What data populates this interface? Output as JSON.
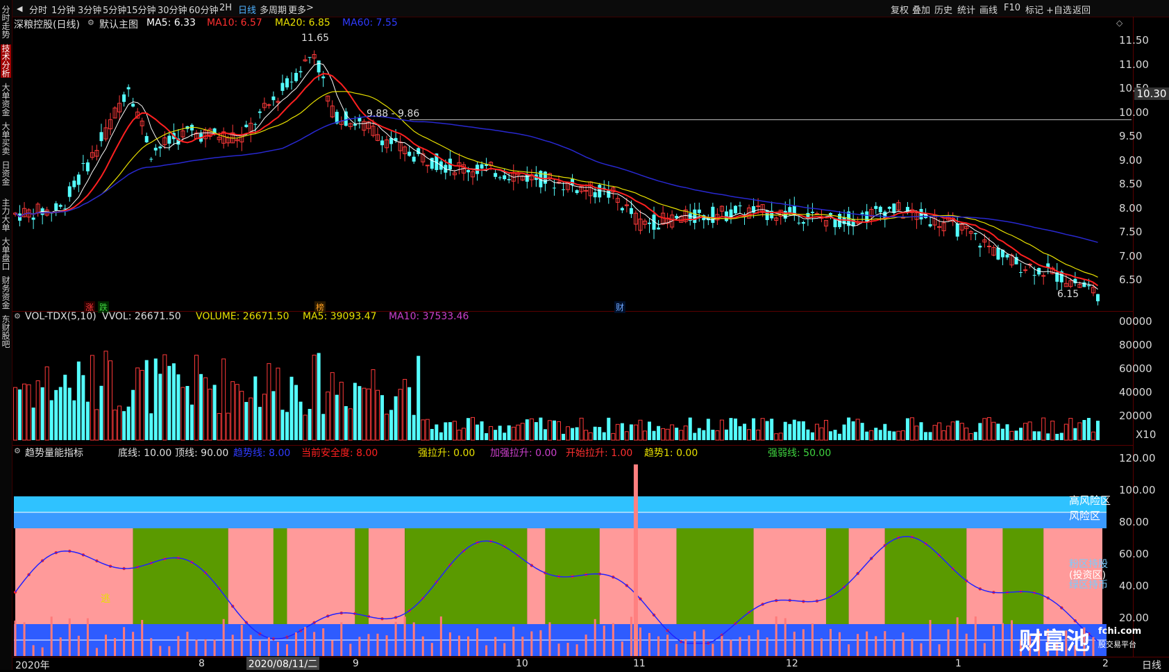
{
  "topbar": {
    "periods": [
      "分时",
      "1分钟",
      "3分钟",
      "5分钟",
      "15分钟",
      "30分钟",
      "60分钟",
      "2H",
      "日线",
      "多周期",
      "更多"
    ],
    "active_period": "日线",
    "right_items": [
      "复权",
      "叠加",
      "历史",
      "统计",
      "画线",
      "F10",
      "标记",
      "+自选",
      "返回"
    ]
  },
  "leftbar": {
    "items": [
      "分时走势",
      "技术分析",
      "大单资金",
      "大单买卖",
      "日资金",
      "主力大单",
      "大单盘口",
      "财务资金",
      "东财股吧"
    ],
    "active": "技术分析"
  },
  "main": {
    "title": "深粮控股(日线)",
    "subtitle": "默认主图",
    "ma5": "MA5: 6.33",
    "ma10": "MA10: 6.57",
    "ma20": "MA20: 6.85",
    "ma60": "MA60: 7.55",
    "high_label": "11.65",
    "low_label": "6.15",
    "hline_label": "9.88 - 9.86",
    "price_axis": [
      "11.50",
      "11.00",
      "10.50",
      "10.00",
      "9.50",
      "9.00",
      "8.50",
      "8.00",
      "7.50",
      "7.00",
      "6.50"
    ],
    "current_price": "10.30",
    "badges": [
      "涨",
      "跌",
      "榜",
      "财"
    ]
  },
  "volume": {
    "title": "VOL-TDX(5,10)",
    "vvol": "VVOL: 26671.50",
    "volume": "VOLUME: 26671.50",
    "ma5": "MA5: 39093.47",
    "ma10": "MA10: 37533.46",
    "axis": [
      "00000",
      "80000",
      "60000",
      "40000",
      "20000"
    ],
    "axis_unit": "X10"
  },
  "indicator": {
    "title": "趋势量能指标",
    "bottom_line": "底线: 10.00",
    "top_line": "顶线: 90.00",
    "trend_line": "趋势线: 8.00",
    "safety": "当前安全度: 8.00",
    "strong_up": "强拉升: 0.00",
    "add_up": "加强拉升: 0.00",
    "start_up": "开始拉升: 1.00",
    "trend1": "趋势1: 0.00",
    "strength_line": "强弱线: 50.00",
    "axis": [
      "120.00",
      "100.00",
      "80.00",
      "60.00",
      "40.00",
      "20.00"
    ],
    "zones": {
      "high_risk": "高风险区",
      "risk": "风险区",
      "invest": "(投资区)",
      "pink_zone": "粉区持股",
      "green_zone": "绿区持币"
    },
    "escape_label": "逃"
  },
  "bottom_axis": {
    "labels": [
      "2020年",
      "8",
      "2020/08/11/二",
      "9",
      "10",
      "11",
      "12",
      "1",
      "2"
    ],
    "period_btn": "日线"
  },
  "watermark": {
    "brand": "财富池",
    "site": "fchi.com",
    "sub": "股交易平台"
  },
  "colors": {
    "up": "#ff3a3a",
    "down": "#54ffff",
    "ma5": "#ffffff",
    "ma10": "#ff2020",
    "ma20": "#e8e000",
    "ma60": "#2828d0",
    "pink": "#ff9a9a",
    "green": "#5a9a00",
    "blue_band": "#2e5cff",
    "cyan_band": "#2fc2ff"
  }
}
